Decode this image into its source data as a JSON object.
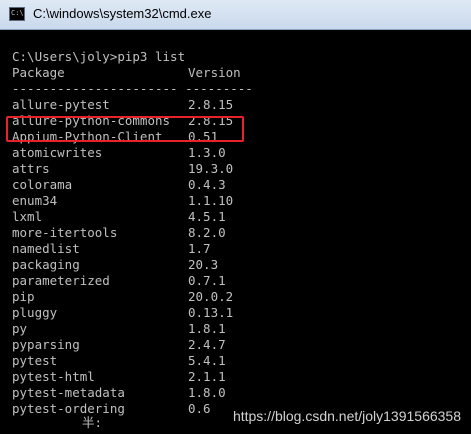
{
  "window": {
    "title": "C:\\windows\\system32\\cmd.exe",
    "icon": "cmd-icon",
    "icon_text": "C:\\"
  },
  "console": {
    "prompt": "C:\\Users\\joly>pip3 list",
    "header": {
      "package": "Package",
      "version": "Version"
    },
    "separator": "---------------------- ---------",
    "packages": [
      {
        "name": "allure-pytest",
        "version": "2.8.15"
      },
      {
        "name": "allure-python-commons",
        "version": "2.8.15"
      },
      {
        "name": "Appium-Python-Client",
        "version": "0.51"
      },
      {
        "name": "atomicwrites",
        "version": "1.3.0"
      },
      {
        "name": "attrs",
        "version": "19.3.0"
      },
      {
        "name": "colorama",
        "version": "0.4.3"
      },
      {
        "name": "enum34",
        "version": "1.1.10"
      },
      {
        "name": "lxml",
        "version": "4.5.1"
      },
      {
        "name": "more-itertools",
        "version": "8.2.0"
      },
      {
        "name": "namedlist",
        "version": "1.7"
      },
      {
        "name": "packaging",
        "version": "20.3"
      },
      {
        "name": "parameterized",
        "version": "0.7.1"
      },
      {
        "name": "pip",
        "version": "20.0.2"
      },
      {
        "name": "pluggy",
        "version": "0.13.1"
      },
      {
        "name": "py",
        "version": "1.8.1"
      },
      {
        "name": "pyparsing",
        "version": "2.4.7"
      },
      {
        "name": "pytest",
        "version": "5.4.1"
      },
      {
        "name": "pytest-html",
        "version": "2.1.1"
      },
      {
        "name": "pytest-metadata",
        "version": "1.8.0"
      },
      {
        "name": "pytest-ordering",
        "version": "0.6"
      }
    ],
    "ime_status": "半:"
  },
  "watermark": "https://blog.csdn.net/joly1391566358",
  "colors": {
    "console_bg": "#000000",
    "console_text": "#c0c0c0",
    "highlight_border": "#e8222b",
    "titlebar": "#dfe9f5"
  }
}
